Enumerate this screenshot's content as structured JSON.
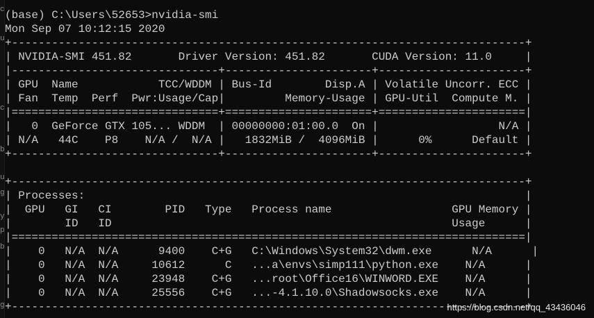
{
  "terminal": {
    "prompt_line": "(base) C:\\Users\\52653>nvidia-smi",
    "timestamp": "Mon Sep 07 10:12:15 2020",
    "gpu_table": {
      "border_top": "+-----------------------------------------------------------------------------+",
      "version_line": "| NVIDIA-SMI 451.82       Driver Version: 451.82       CUDA Version: 11.0     |",
      "sep_1": "|-------------------------------+----------------------+----------------------+",
      "header_1": "| GPU  Name            TCC/WDDM | Bus-Id        Disp.A | Volatile Uncorr. ECC |",
      "header_2": "| Fan  Temp  Perf  Pwr:Usage/Cap|         Memory-Usage | GPU-Util  Compute M. |",
      "sep_2": "|===============================+======================+======================|",
      "gpu_row_1": "|   0  GeForce GTX 105... WDDM  | 00000000:01:00.0  On |                  N/A |",
      "gpu_row_2": "| N/A   44C    P8    N/A /  N/A |   1832MiB /  4096MiB |      0%      Default |",
      "border_bottom": "+-------------------------------+----------------------+----------------------+"
    },
    "processes_table": {
      "border_top": "+-----------------------------------------------------------------------------+",
      "title_line": "| Processes:                                                                  |",
      "header_1": "|  GPU   GI   CI        PID   Type   Process name                  GPU Memory |",
      "header_2": "|        ID   ID                                                   Usage      |",
      "sep": "|=============================================================================|",
      "rows": [
        "|    0   N/A  N/A      9400    C+G   C:\\Windows\\System32\\dwm.exe      N/A      |",
        "|    0   N/A  N/A     10612      C   ...a\\envs\\simp111\\python.exe    N/A      |",
        "|    0   N/A  N/A     23948    C+G   ...root\\Office16\\WINWORD.EXE    N/A      |",
        "|    0   N/A  N/A     25556    C+G   ...-4.1.10.0\\Shadowsocks.exe    N/A      |",
        "+-----------------------------------------------------------------------------+"
      ]
    }
  },
  "left_edge_glyphs": [
    "c",
    "u",
    "c",
    "b",
    "u",
    "g",
    "y",
    "p",
    "b",
    "g"
  ],
  "watermark": "https://blog.csdn.net/qq_43436046",
  "colors": {
    "background": "#0c0c0c",
    "text": "#cccccc",
    "watermark": "#e8e8e8"
  }
}
